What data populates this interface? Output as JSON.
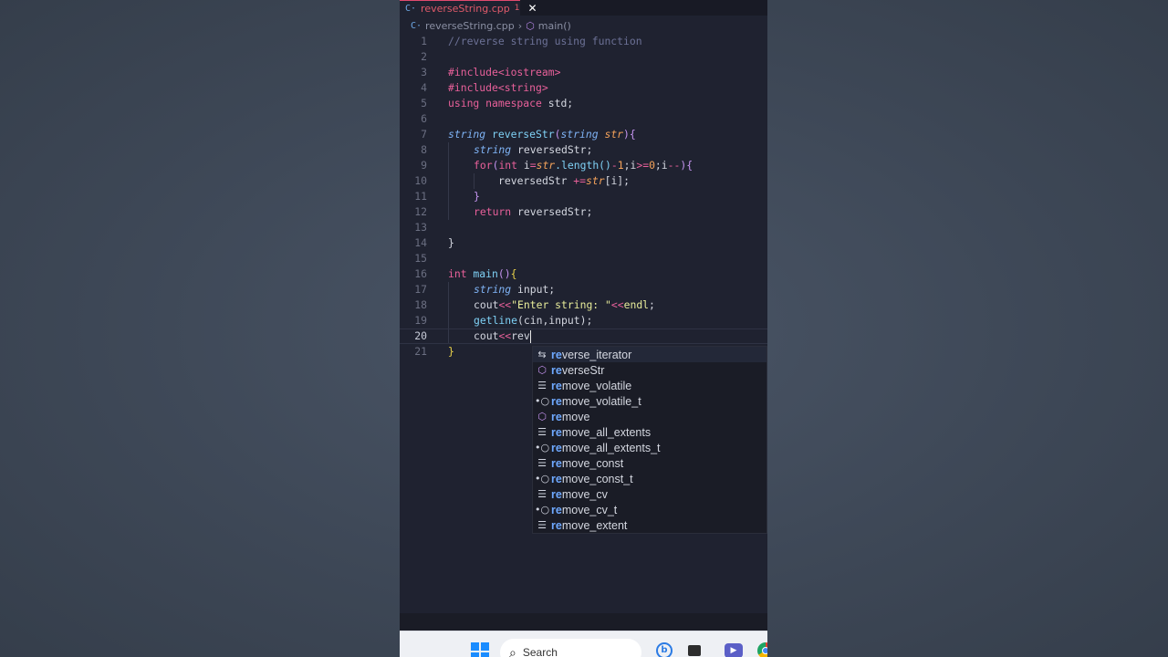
{
  "tab": {
    "file_icon": "C·",
    "filename": "reverseString.cpp",
    "modified": "1",
    "close": "✕"
  },
  "breadcrumb": {
    "file_icon": "C·",
    "file": "reverseString.cpp",
    "separator": "›",
    "symbol_icon": "⬡",
    "symbol": "main()"
  },
  "editor": {
    "line_numbers": [
      "1",
      "2",
      "3",
      "4",
      "5",
      "6",
      "7",
      "8",
      "9",
      "10",
      "11",
      "12",
      "13",
      "14",
      "15",
      "16",
      "17",
      "18",
      "19",
      "20",
      "21"
    ],
    "current_line": "20"
  },
  "code": {
    "l1": "//reverse string using function",
    "l3": "#include<iostream>",
    "l4": "#include<string>",
    "l5_kw": "using namespace",
    "l5_rest": " std;",
    "l7_type": "string",
    "l7_fn": "reverseStr",
    "l7_open": "(",
    "l7_ptype": "string",
    "l7_param": "str",
    "l7_close": "){",
    "l8_type": "string",
    "l8_rest": " reversedStr;",
    "l9_kw": "for",
    "l9_open": "(",
    "l9_int": "int",
    "l9_i": " i",
    "l9_eq": "=",
    "l9_str": "str",
    "l9_dot": ".length()",
    "l9_minus": "-",
    "l9_one": "1",
    "l9_semi": ";i",
    "l9_ge": ">=",
    "l9_zero": "0",
    "l9_end": ";i",
    "l9_dec": "--",
    "l9_close": "){",
    "l10_var": "reversedStr ",
    "l10_op": "+=",
    "l10_str": "str",
    "l10_idx": "[i];",
    "l11": "}",
    "l12_kw": "return",
    "l12_rest": " reversedStr;",
    "l14": "}",
    "l16_kw": "int",
    "l16_fn": " main",
    "l16_paren": "()",
    "l16_brace": "{",
    "l17_type": "string",
    "l17_rest": " input;",
    "l18_cout": "cout",
    "l18_op": "<<",
    "l18_str": "\"Enter string: \"",
    "l18_op2": "<<",
    "l18_endl": "endl",
    "l18_semi": ";",
    "l19_fn": "getline",
    "l19_rest": "(cin,input);",
    "l20_cout": "cout",
    "l20_op": "<<",
    "l20_typed": "rev",
    "l21": "}"
  },
  "suggestions": [
    {
      "icon": "type-parameter-icon",
      "glyph": "⇆",
      "match": "re",
      "rest": "verse_iterator",
      "selected": true
    },
    {
      "icon": "method-icon",
      "glyph": "⬡",
      "match": "re",
      "rest": "verseStr"
    },
    {
      "icon": "struct-icon",
      "glyph": "☰",
      "match": "re",
      "rest": "move_volatile"
    },
    {
      "icon": "typedef-icon",
      "glyph": "•○",
      "match": "re",
      "rest": "move_volatile_t"
    },
    {
      "icon": "method-icon",
      "glyph": "⬡",
      "match": "re",
      "rest": "move"
    },
    {
      "icon": "struct-icon",
      "glyph": "☰",
      "match": "re",
      "rest": "move_all_extents"
    },
    {
      "icon": "typedef-icon",
      "glyph": "•○",
      "match": "re",
      "rest": "move_all_extents_t"
    },
    {
      "icon": "struct-icon",
      "glyph": "☰",
      "match": "re",
      "rest": "move_const"
    },
    {
      "icon": "typedef-icon",
      "glyph": "•○",
      "match": "re",
      "rest": "move_const_t"
    },
    {
      "icon": "struct-icon",
      "glyph": "☰",
      "match": "re",
      "rest": "move_cv"
    },
    {
      "icon": "typedef-icon",
      "glyph": "•○",
      "match": "re",
      "rest": "move_cv_t"
    },
    {
      "icon": "struct-icon",
      "glyph": "☰",
      "match": "re",
      "rest": "move_extent"
    }
  ],
  "taskbar": {
    "search_glyph": "⌕",
    "search_placeholder": "Search",
    "bing_glyph": "b",
    "meet_glyph": "▶"
  }
}
